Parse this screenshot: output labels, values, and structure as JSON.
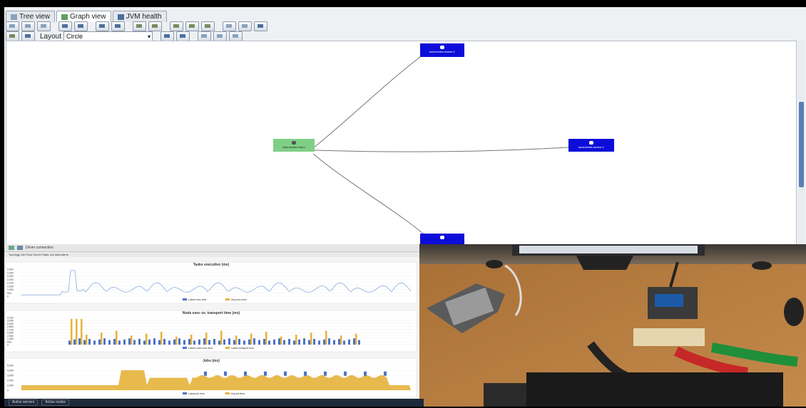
{
  "app": {
    "tabs": [
      {
        "label": "Tree view",
        "icon": "tree-icon"
      },
      {
        "label": "Graph view",
        "icon": "graph-icon"
      },
      {
        "label": "JVM health",
        "icon": "health-icon"
      }
    ],
    "layout_label": "Layout",
    "layout_value": "Circle"
  },
  "graph": {
    "nodes": [
      {
        "id": "master",
        "label": "kast.docker.intern",
        "color": "#7fcf86",
        "text_color": "#222"
      },
      {
        "id": "k1",
        "label": "kubernetes.docker.1",
        "color": "#0d0dd9",
        "text_color": "#fff"
      },
      {
        "id": "k2",
        "label": "kubernetes.docker.1",
        "color": "#0d0dd9",
        "text_color": "#fff"
      },
      {
        "id": "k3",
        "label": "",
        "color": "#0d0dd9",
        "text_color": "#fff"
      }
    ]
  },
  "monitor": {
    "toolbar_text": "Driver connection",
    "sub_tabs": "Topology  Job Flow  Server Stats  Job data  Alerts",
    "charts": [
      {
        "title": "Tasks execution (ms)",
        "legend": [
          "Latest exec time",
          "Avg exec time"
        ],
        "y_ticks": [
          "2,500",
          "2,400",
          "2,300",
          "2,200",
          "2,100",
          "2,000",
          "1,900",
          "500",
          "0"
        ]
      },
      {
        "title": "Node exec vs. transport time (ms)",
        "legend": [
          "Latest node exec time",
          "Latest transport time"
        ],
        "y_ticks": [
          "3,100",
          "3,000",
          "2,900",
          "2,800",
          "2,700",
          "2,600",
          "2,500",
          "1,000",
          "500",
          "0"
        ]
      },
      {
        "title": "Jobs (ms)",
        "legend": [
          "Latest job time",
          "Avg job time"
        ],
        "y_ticks": [
          "5,000",
          "4,000",
          "3,000",
          "2,000",
          "1,000",
          "0"
        ]
      }
    ],
    "bottom_tabs": [
      "Active servers",
      "Active nodes"
    ]
  },
  "colors": {
    "accent": "#0d0dd9",
    "master": "#7fcf86",
    "bar_blue": "#4b73c6",
    "bar_orange": "#e6b33a"
  }
}
